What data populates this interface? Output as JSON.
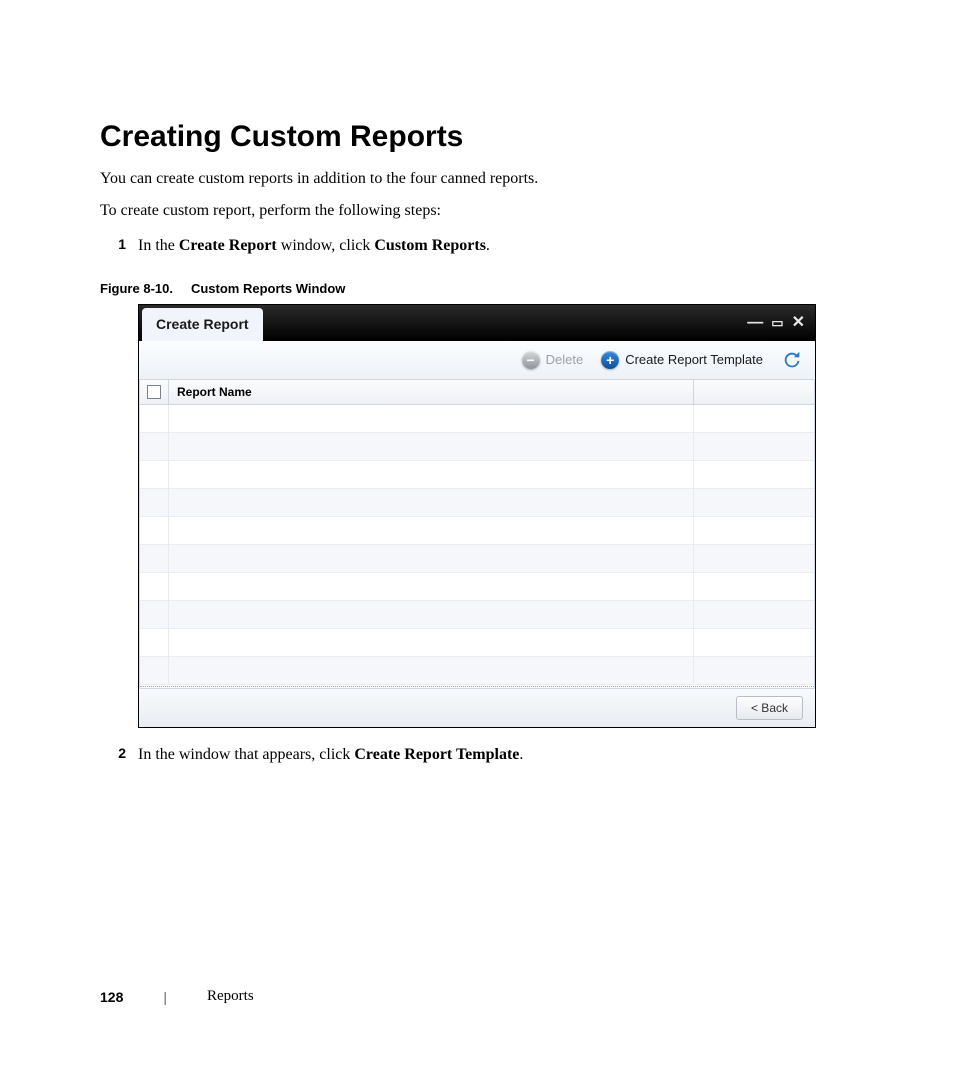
{
  "heading": "Creating Custom Reports",
  "intro1": "You can create custom reports in addition to the four canned reports.",
  "intro2": "To create custom report, perform the following steps:",
  "steps": {
    "s1": {
      "num": "1",
      "pre": "In the ",
      "b1": "Create Report",
      "mid": " window, click ",
      "b2": "Custom Reports",
      "post": "."
    },
    "s2": {
      "num": "2",
      "pre": "In the window that appears, click ",
      "b1": "Create Report Template",
      "post": "."
    }
  },
  "figure": {
    "label": "Figure 8-10.",
    "title": "Custom Reports Window"
  },
  "screenshot": {
    "window_title": "Create Report",
    "toolbar": {
      "delete": "Delete",
      "create_template": "Create Report Template"
    },
    "grid": {
      "header": "Report Name"
    },
    "footer": {
      "back": "< Back"
    }
  },
  "pagefooter": {
    "page": "128",
    "section": "Reports"
  }
}
